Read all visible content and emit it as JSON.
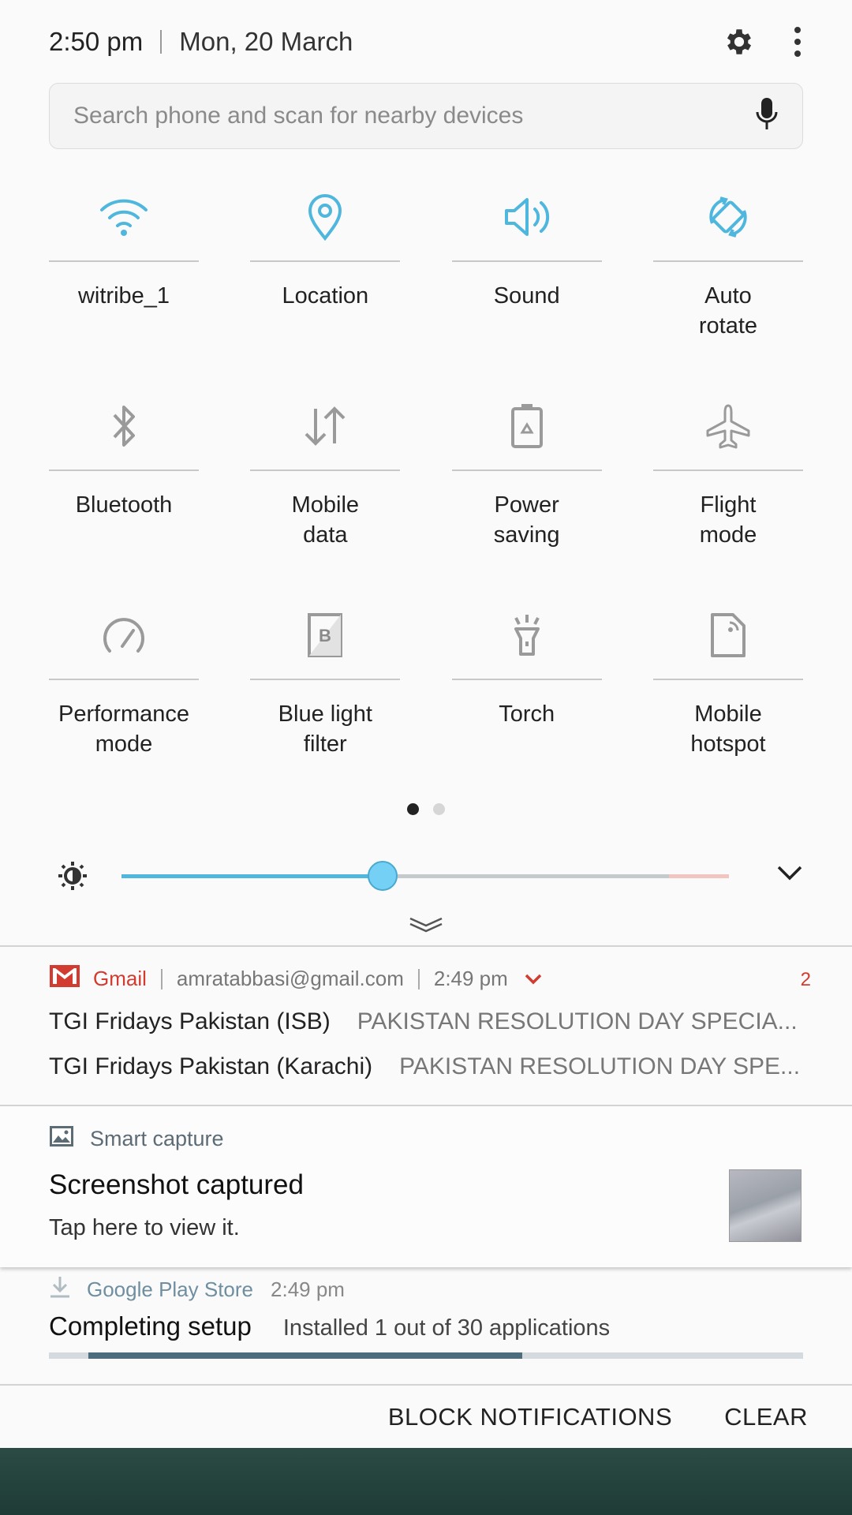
{
  "header": {
    "time": "2:50 pm",
    "date": "Mon, 20 March",
    "settings_icon": "gear-icon",
    "more_icon": "more-vert-icon"
  },
  "search": {
    "placeholder": "Search phone and scan for nearby devices",
    "mic_icon": "mic-icon"
  },
  "tiles": [
    {
      "label": "witribe_1",
      "icon": "wifi-icon",
      "active": true
    },
    {
      "label": "Location",
      "icon": "location-icon",
      "active": true
    },
    {
      "label": "Sound",
      "icon": "volume-icon",
      "active": true
    },
    {
      "label": "Auto\nrotate",
      "icon": "auto-rotate-icon",
      "active": true
    },
    {
      "label": "Bluetooth",
      "icon": "bluetooth-icon",
      "active": false
    },
    {
      "label": "Mobile\ndata",
      "icon": "mobile-data-icon",
      "active": false
    },
    {
      "label": "Power\nsaving",
      "icon": "battery-saver-icon",
      "active": false
    },
    {
      "label": "Flight\nmode",
      "icon": "airplane-icon",
      "active": false
    },
    {
      "label": "Performance\nmode",
      "icon": "speedometer-icon",
      "active": false
    },
    {
      "label": "Blue light\nfilter",
      "icon": "blue-light-icon",
      "active": false
    },
    {
      "label": "Torch",
      "icon": "flashlight-icon",
      "active": false
    },
    {
      "label": "Mobile\nhotspot",
      "icon": "hotspot-icon",
      "active": false
    }
  ],
  "pages": {
    "count": 2,
    "active": 0
  },
  "brightness": {
    "level": 0.43
  },
  "colors": {
    "accent": "#4fb6dd",
    "inactive_icon": "#9a9a9a",
    "gmail": "#d23b2f"
  },
  "gmail": {
    "app": "Gmail",
    "account": "amratabbasi@gmail.com",
    "time": "2:49 pm",
    "count": "2",
    "messages": [
      {
        "from": "TGI Fridays Pakistan (ISB)",
        "subject": "PAKISTAN RESOLUTION DAY SPECIA..."
      },
      {
        "from": "TGI Fridays Pakistan (Karachi)",
        "subject": "PAKISTAN RESOLUTION DAY SPE..."
      }
    ]
  },
  "smart_capture": {
    "app": "Smart capture",
    "title": "Screenshot captured",
    "subtitle": "Tap here to view it."
  },
  "play_store": {
    "app": "Google Play Store",
    "time": "2:49 pm",
    "title": "Completing setup",
    "text": "Installed 1 out of 30 applications",
    "progress_start": 0.052,
    "progress_end": 0.628
  },
  "actions": {
    "block": "BLOCK NOTIFICATIONS",
    "clear": "CLEAR"
  }
}
